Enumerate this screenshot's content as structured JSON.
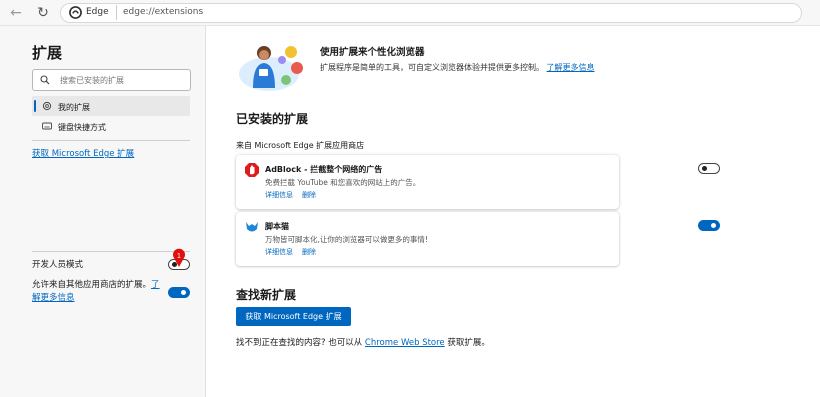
{
  "browser": {
    "address_name": "Edge",
    "address_url": "edge://extensions"
  },
  "sidebar": {
    "title": "扩展",
    "search_placeholder": "搜索已安装的扩展",
    "items": [
      {
        "label": "我的扩展",
        "icon": "gear-icon",
        "active": true
      },
      {
        "label": "键盘快捷方式",
        "icon": "keyboard-icon",
        "active": false
      }
    ],
    "get_extensions_link": "获取 Microsoft Edge 扩展",
    "developer_mode_label": "开发人员模式",
    "developer_mode_on": false,
    "allow_other_stores_text": "允许来自其他应用商店的扩展。",
    "allow_other_stores_link": "了解更多信息",
    "allow_other_stores_on": true,
    "marker_number": "1"
  },
  "main": {
    "hero_title": "使用扩展来个性化浏览器",
    "hero_desc": "扩展程序是简单的工具，可自定义浏览器体验并提供更多控制。",
    "hero_link": "了解更多信息",
    "installed_heading": "已安装的扩展",
    "from_store": "来自 Microsoft Edge 扩展应用商店",
    "extensions": [
      {
        "name": "AdBlock - 拦截整个网络的广告",
        "desc": "免费拦截 YouTube 和您喜欢的网站上的广告。",
        "details": "详细信息",
        "remove": "删除",
        "enabled": false,
        "icon": "adblock-icon"
      },
      {
        "name": "脚本猫",
        "desc": "万物皆可脚本化,让你的浏览器可以做更多的事情!",
        "details": "详细信息",
        "remove": "删除",
        "enabled": true,
        "icon": "scriptcat-icon"
      }
    ],
    "find_heading": "查找新扩展",
    "get_button": "获取 Microsoft Edge 扩展",
    "find_text_prefix": "找不到正在查找的内容? 也可以从",
    "find_text_link": "Chrome Web Store",
    "find_text_suffix": "获取扩展。"
  },
  "colors": {
    "accent": "#0067c0",
    "marker": "#e01010"
  }
}
